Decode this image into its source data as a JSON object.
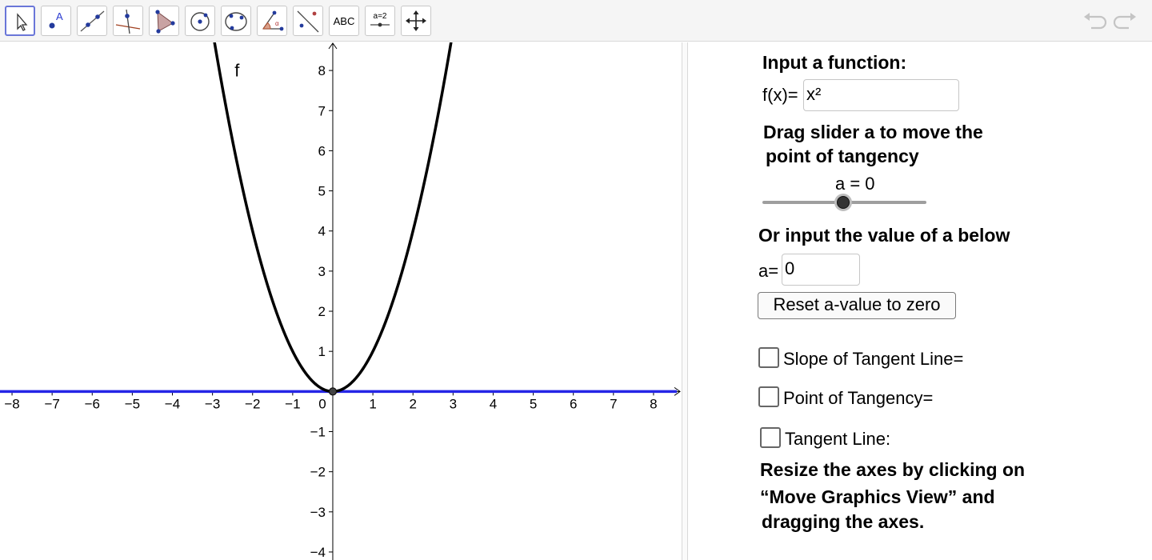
{
  "toolbar": {
    "tools": [
      {
        "name": "move-tool"
      },
      {
        "name": "point-tool"
      },
      {
        "name": "line-tool"
      },
      {
        "name": "perpendicular-line-tool"
      },
      {
        "name": "polygon-tool"
      },
      {
        "name": "circle-center-point-tool"
      },
      {
        "name": "conic-five-points-tool"
      },
      {
        "name": "angle-tool"
      },
      {
        "name": "reflect-tool"
      },
      {
        "name": "text-tool",
        "label": "ABC"
      },
      {
        "name": "slider-tool",
        "label": "a=2"
      },
      {
        "name": "move-graphics-view-tool"
      }
    ]
  },
  "graph": {
    "function_label": "f",
    "x_ticks": [
      "−8",
      "−7",
      "−6",
      "−5",
      "−4",
      "−3",
      "−2",
      "−1",
      "0",
      "1",
      "2",
      "3",
      "4",
      "5",
      "6",
      "7",
      "8"
    ],
    "y_ticks": [
      "8",
      "7",
      "6",
      "5",
      "4",
      "3",
      "2",
      "1",
      "−1",
      "−2",
      "−3",
      "−4"
    ],
    "colors": {
      "curve": "#000000",
      "tangent": "#2626e6",
      "point": "#444444"
    }
  },
  "chart_data": {
    "type": "line",
    "series": [
      {
        "name": "f",
        "formula": "x^2",
        "x": [
          -3,
          -2,
          -1,
          0,
          1,
          2,
          3
        ],
        "values": [
          9,
          4,
          1,
          0,
          1,
          4,
          9
        ]
      },
      {
        "name": "tangent",
        "x": [
          -8.3,
          8.7
        ],
        "values": [
          0,
          0
        ]
      }
    ],
    "point": {
      "x": 0,
      "y": 0
    },
    "xlim": [
      -8.3,
      8.7
    ],
    "ylim": [
      -4.2,
      8.7
    ],
    "grid": false
  },
  "panel": {
    "input_function_title": "Input a function:",
    "fx_label": "f(x)=",
    "fx_value": "x²",
    "drag_line1": "Drag slider a to move the",
    "drag_line2": "point of tangency",
    "slider_label": "a = 0",
    "slider_value": 0,
    "or_input": "Or input the value of a below",
    "a_label": "a=",
    "a_value": "0",
    "reset_button": "Reset a-value to zero",
    "checkbox_slope": "Slope of Tangent Line=",
    "checkbox_point": "Point of Tangency=",
    "checkbox_tangent": "Tangent Line:",
    "resize_line1": "Resize the axes by clicking on",
    "resize_line2": "“Move Graphics View” and",
    "resize_line3": "dragging the axes."
  }
}
